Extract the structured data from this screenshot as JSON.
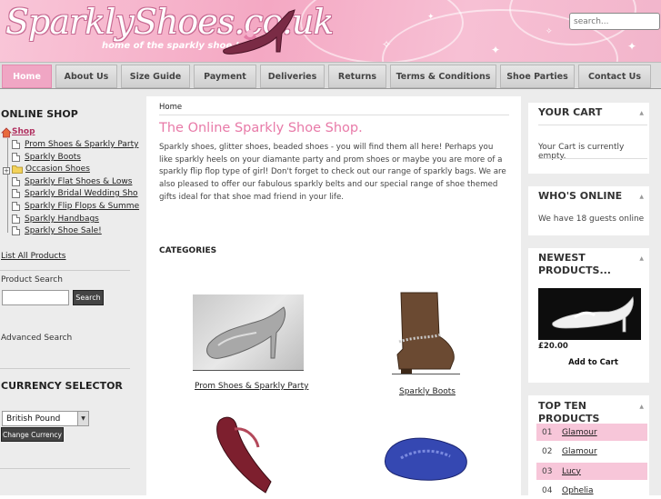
{
  "header": {
    "logo_text": "SparklyShoes.co.uk",
    "tagline": "home of the sparkly shoe !",
    "search_placeholder": "search..."
  },
  "nav": {
    "items": [
      "Home",
      "About Us",
      "Size Guide",
      "Payment",
      "Deliveries",
      "Returns",
      "Terms & Conditions",
      "Shoe Parties",
      "Contact Us"
    ],
    "active": "Home"
  },
  "left": {
    "online_shop_title": "ONLINE SHOP",
    "shop_label": "Shop",
    "categories": [
      "Prom Shoes & Sparkly Party",
      "Sparkly Boots",
      "Occasion Shoes",
      "Sparkly Flat Shoes & Lows",
      "Sparkly Bridal Wedding Sho",
      "Sparkly Flip Flops & Summe",
      "Sparkly Handbags",
      "Sparkly Shoe Sale!"
    ],
    "expandable_toggle": "+",
    "list_all": "List All Products",
    "product_search_label": "Product Search",
    "search_button": "Search",
    "advanced_search": "Advanced Search",
    "currency_title": "CURRENCY SELECTOR",
    "currency_value": "British Pound",
    "change_currency_button": "Change Currency"
  },
  "main": {
    "breadcrumb": "Home",
    "title": "The Online Sparkly Shoe Shop.",
    "intro": "Sparkly shoes, glitter shoes, beaded shoes - you will find them all here!  Perhaps you like sparkly heels on your diamante party and prom shoes or maybe you are more of a sparkly flip flop type of girl!  Don't forget to check out our range of sparkly bags. We are also pleased to offer our fabulous sparkly belts and our special range of shoe themed gifts ideal for that shoe mad friend in your life.",
    "categories_heading": "CATEGORIES",
    "category_tiles": [
      {
        "label": "Prom Shoes & Sparkly Party"
      },
      {
        "label": "Sparkly Boots"
      },
      {
        "label": ""
      },
      {
        "label": ""
      }
    ]
  },
  "right": {
    "cart_title": "YOUR CART",
    "cart_text": "Your Cart is currently empty.",
    "online_title": "WHO'S ONLINE",
    "online_text": "We have 18 guests online",
    "newest_title": "NEWEST PRODUCTS...",
    "newest_price": "£20.00",
    "add_to_cart": "Add to Cart",
    "top_ten_title": "TOP TEN PRODUCTS",
    "top_ten": [
      {
        "num": "01",
        "name": "Glamour"
      },
      {
        "num": "02",
        "name": "Glamour"
      },
      {
        "num": "03",
        "name": "Lucy"
      },
      {
        "num": "04",
        "name": "Ophelia"
      }
    ],
    "collapse_glyph": "▲"
  },
  "colors": {
    "accent_pink": "#e87aa8",
    "nav_active": "#f0a6c4",
    "row_highlight": "#f7c6d9"
  }
}
